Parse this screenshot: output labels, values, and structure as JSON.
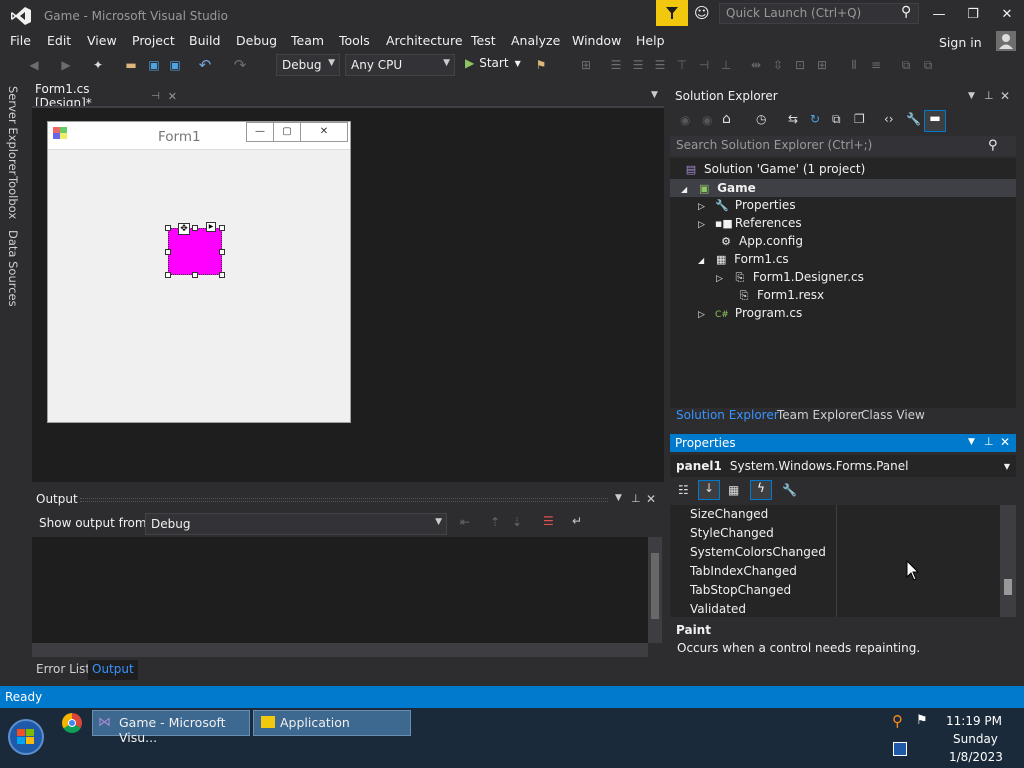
{
  "window": {
    "title": "Game - Microsoft Visual Studio",
    "quick_launch_placeholder": "Quick Launch (Ctrl+Q)",
    "minimize": "—",
    "maximize": "❐",
    "close": "✕"
  },
  "menu": [
    "File",
    "Edit",
    "View",
    "Project",
    "Build",
    "Debug",
    "Team",
    "Tools",
    "Architecture",
    "Test",
    "Analyze",
    "Window",
    "Help"
  ],
  "sign_in": "Sign in",
  "toolbar": {
    "configuration": "Debug",
    "platform": "Any CPU",
    "start_label": "Start"
  },
  "side_tabs": [
    "Server Explorer",
    "Toolbox",
    "Data Sources"
  ],
  "editor": {
    "tab_label": "Form1.cs [Design]*",
    "form_caption": "Form1"
  },
  "output": {
    "title": "Output",
    "show_from_label": "Show output from:",
    "source": "Debug",
    "tabs": [
      "Error List",
      "Output"
    ]
  },
  "solution_explorer": {
    "title": "Solution Explorer",
    "search_placeholder": "Search Solution Explorer (Ctrl+;)",
    "items": [
      {
        "label": "Solution 'Game' (1 project)",
        "icon": "solution-icon",
        "arrow": ""
      },
      {
        "label": "Game",
        "icon": "csharp-project-icon",
        "arrow": "◢"
      },
      {
        "label": "Properties",
        "icon": "wrench-icon",
        "arrow": "▷"
      },
      {
        "label": "References",
        "icon": "references-icon",
        "arrow": "▷"
      },
      {
        "label": "App.config",
        "icon": "config-file-icon",
        "arrow": ""
      },
      {
        "label": "Form1.cs",
        "icon": "form-icon",
        "arrow": "◢"
      },
      {
        "label": "Form1.Designer.cs",
        "icon": "cs-file-icon",
        "arrow": "▷"
      },
      {
        "label": "Form1.resx",
        "icon": "resx-file-icon",
        "arrow": ""
      },
      {
        "label": "Program.cs",
        "icon": "csharp-file-icon",
        "arrow": "▷"
      }
    ],
    "tabs": [
      "Solution Explorer",
      "Team Explorer",
      "Class View"
    ]
  },
  "properties": {
    "title": "Properties",
    "object_name": "panel1",
    "object_type": "System.Windows.Forms.Panel",
    "events": [
      "SizeChanged",
      "StyleChanged",
      "SystemColorsChanged",
      "TabIndexChanged",
      "TabStopChanged",
      "Validated"
    ],
    "desc_title": "Paint",
    "desc_text": "Occurs when a control needs repainting."
  },
  "status": {
    "text": "Ready"
  },
  "taskbar": {
    "items": [
      "Game - Microsoft Visu...",
      "Application"
    ],
    "time": "11:19 PM",
    "day": "Sunday",
    "date": "1/8/2023"
  },
  "colors": {
    "accent": "#007acc",
    "panel": "#ff00ff",
    "notification": "#f2c80f"
  }
}
